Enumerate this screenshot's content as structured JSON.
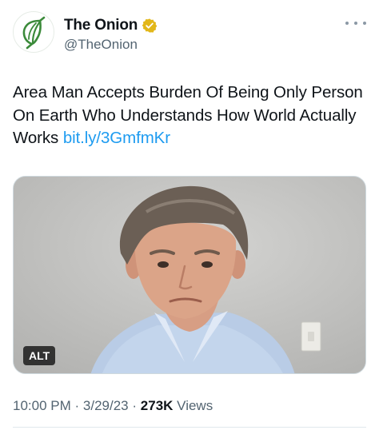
{
  "author": {
    "display_name": "The Onion",
    "handle": "@TheOnion",
    "verified_badge_color": "#e2b719",
    "avatar_icon": "onion-logo-icon",
    "avatar_color": "#3b8a3a"
  },
  "tweet": {
    "text": "Area Man Accepts Burden Of Being Only Person On Earth Who Understands How World Actually Works",
    "link": "bit.ly/3GmfmKr",
    "link_color": "#1d9bf0"
  },
  "media": {
    "alt_label": "ALT"
  },
  "meta": {
    "time": "10:00 PM",
    "date": "3/29/23",
    "views_count": "273K",
    "views_label": "Views",
    "separator": "·"
  }
}
